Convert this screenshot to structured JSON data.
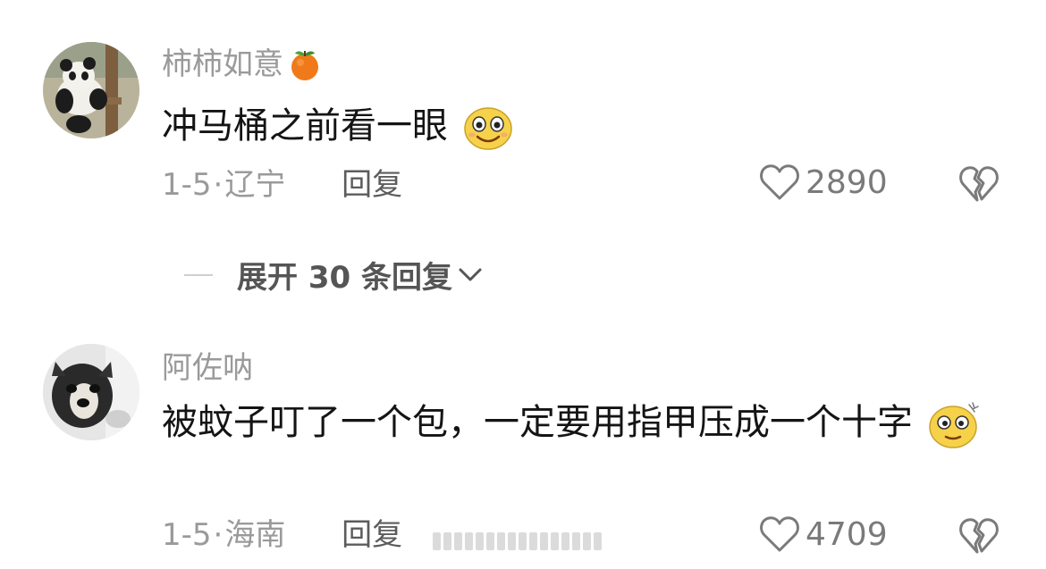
{
  "comments": [
    {
      "username": "柿柿如意",
      "username_emoji": "persimmon-emoji",
      "text": "冲马桶之前看一眼",
      "text_emoji": "smiling-face-emoji",
      "date": "1-5",
      "location": "辽宁",
      "reply_label": "回复",
      "likes": "2890",
      "expand_replies_label": "展开 30 条回复"
    },
    {
      "username": "阿佐呐",
      "text": "被蚊子叮了一个包，一定要用指甲压成一个十字",
      "text_emoji": "dazed-face-emoji",
      "date": "1-5",
      "location": "海南",
      "reply_label": "回复",
      "likes": "4709"
    }
  ],
  "colors": {
    "username": "#9a9a9a",
    "text": "#141414",
    "meta": "#9a9a9a",
    "reply": "#5c5c5c",
    "expand": "#555555",
    "icon": "#7a7a7a"
  },
  "icons": [
    "heart-outline-icon",
    "broken-heart-icon",
    "chevron-down-icon"
  ]
}
